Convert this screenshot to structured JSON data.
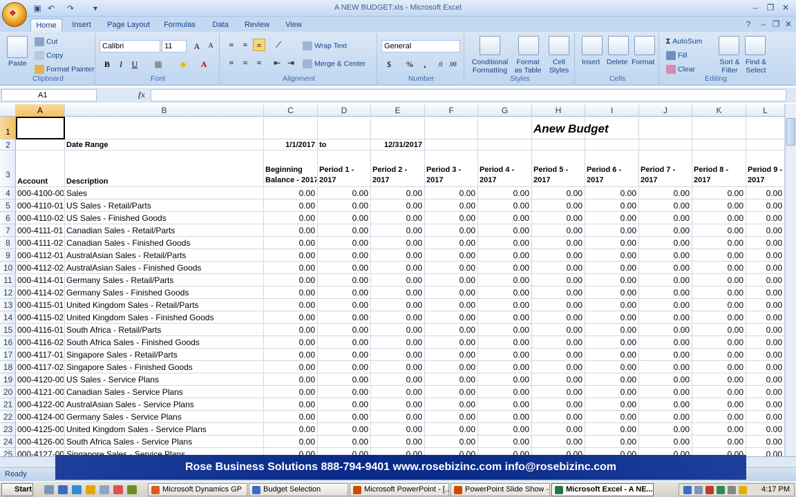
{
  "window": {
    "title": "A NEW BUDGET.xls - Microsoft Excel"
  },
  "tabs": [
    "Home",
    "Insert",
    "Page Layout",
    "Formulas",
    "Data",
    "Review",
    "View"
  ],
  "ribbon": {
    "clipboard": {
      "paste": "Paste",
      "cut": "Cut",
      "copy": "Copy",
      "format_painter": "Format Painter",
      "label": "Clipboard"
    },
    "font": {
      "name": "Calibri",
      "size": "11",
      "bold": "B",
      "italic": "I",
      "underline": "U",
      "label": "Font"
    },
    "alignment": {
      "wrap": "Wrap Text",
      "merge": "Merge & Center",
      "label": "Alignment"
    },
    "number": {
      "format": "General",
      "currency": "$",
      "percent": "%",
      "comma": ",",
      "label": "Number"
    },
    "styles": {
      "conditional": "Conditional",
      "conditional2": "Formatting",
      "format_table": "Format",
      "format_table2": "as Table",
      "cell_styles": "Cell",
      "cell_styles2": "Styles",
      "label": "Styles"
    },
    "cells": {
      "insert": "Insert",
      "delete": "Delete",
      "format": "Format",
      "label": "Cells"
    },
    "editing": {
      "autosum": "AutoSum",
      "fill": "Fill",
      "clear": "Clear",
      "sort": "Sort &",
      "sort2": "Filter",
      "find": "Find &",
      "find2": "Select",
      "label": "Editing"
    }
  },
  "formula_bar": {
    "name_box": "A1",
    "fx": "fx",
    "formula": ""
  },
  "columns": [
    "A",
    "B",
    "C",
    "D",
    "E",
    "F",
    "G",
    "H",
    "I",
    "J",
    "K",
    "L"
  ],
  "sheet": {
    "title": "Anew Budget",
    "date_range_label": "Date Range",
    "start_date": "1/1/2017",
    "to": "to",
    "end_date": "12/31/2017",
    "headers": {
      "account": "Account",
      "description": "Description",
      "c": [
        "Beginning",
        "Balance - 2017"
      ],
      "periods": [
        [
          "Period 1 -",
          "2017"
        ],
        [
          "Period 2 -",
          "2017"
        ],
        [
          "Period 3 -",
          "2017"
        ],
        [
          "Period 4 -",
          "2017"
        ],
        [
          "Period 5 -",
          "2017"
        ],
        [
          "Period 6 -",
          "2017"
        ],
        [
          "Period 7 -",
          "2017"
        ],
        [
          "Period 8 -",
          "2017"
        ],
        [
          "Period 9 -",
          "2017"
        ]
      ]
    },
    "zero": "0.00",
    "rows": [
      {
        "n": "4",
        "account": "000-4100-00",
        "desc": "Sales"
      },
      {
        "n": "5",
        "account": "000-4110-01",
        "desc": "US Sales - Retail/Parts"
      },
      {
        "n": "6",
        "account": "000-4110-02",
        "desc": "US Sales - Finished Goods"
      },
      {
        "n": "7",
        "account": "000-4111-01",
        "desc": "Canadian Sales - Retail/Parts"
      },
      {
        "n": "8",
        "account": "000-4111-02",
        "desc": "Canadian Sales - Finished Goods"
      },
      {
        "n": "9",
        "account": "000-4112-01",
        "desc": "AustralAsian Sales - Retail/Parts"
      },
      {
        "n": "10",
        "account": "000-4112-02",
        "desc": "AustralAsian Sales - Finished Goods"
      },
      {
        "n": "11",
        "account": "000-4114-01",
        "desc": "Germany Sales - Retail/Parts"
      },
      {
        "n": "12",
        "account": "000-4114-02",
        "desc": "Germany Sales - Finished Goods"
      },
      {
        "n": "13",
        "account": "000-4115-01",
        "desc": "United Kingdom Sales - Retail/Parts"
      },
      {
        "n": "14",
        "account": "000-4115-02",
        "desc": "United Kingdom Sales - Finished Goods"
      },
      {
        "n": "15",
        "account": "000-4116-01",
        "desc": "South Africa - Retail/Parts"
      },
      {
        "n": "16",
        "account": "000-4116-02",
        "desc": "South Africa Sales - Finished Goods"
      },
      {
        "n": "17",
        "account": "000-4117-01",
        "desc": "Singapore Sales - Retail/Parts"
      },
      {
        "n": "18",
        "account": "000-4117-02",
        "desc": "Singapore Sales - Finished Goods"
      },
      {
        "n": "19",
        "account": "000-4120-00",
        "desc": "US Sales - Service Plans"
      },
      {
        "n": "20",
        "account": "000-4121-00",
        "desc": "Canadian Sales - Service Plans"
      },
      {
        "n": "21",
        "account": "000-4122-00",
        "desc": "AustralAsian Sales - Service Plans"
      },
      {
        "n": "22",
        "account": "000-4124-00",
        "desc": "Germany Sales - Service Plans"
      },
      {
        "n": "23",
        "account": "000-4125-00",
        "desc": "United Kingdom Sales - Service Plans"
      },
      {
        "n": "24",
        "account": "000-4126-00",
        "desc": "South Africa Sales - Service Plans"
      },
      {
        "n": "25",
        "account": "000-4127-00",
        "desc": "Singapore Sales - Service Plans"
      }
    ]
  },
  "banner": "Rose Business Solutions  888-794-9401  www.rosebizinc.com  info@rosebizinc.com",
  "status": {
    "text": "Ready"
  },
  "taskbar": {
    "start": "Start",
    "tasks": [
      "Microsoft Dynamics GP",
      "Budget Selection",
      "Microsoft PowerPoint - [...",
      "PowerPoint Slide Show - ...",
      "Microsoft Excel - A NE..."
    ],
    "clock": "4:17 PM"
  },
  "colors": {
    "accent": "#15428b",
    "selected_header": "#f1c15f",
    "banner": "#0b2b8a"
  }
}
